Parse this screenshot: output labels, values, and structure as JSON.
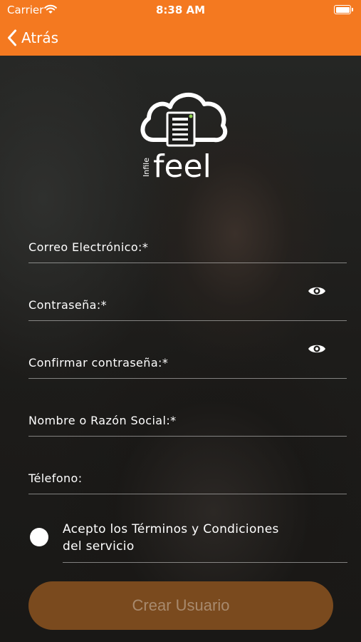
{
  "status_bar": {
    "carrier": "Carrier",
    "time": "8:38 AM"
  },
  "nav": {
    "back_label": "Atrás"
  },
  "logo": {
    "brand_small": "Infile",
    "brand_main": "feel"
  },
  "form": {
    "email_label": "Correo Electrónico:*",
    "password_label": "Contraseña:*",
    "confirm_label": "Confirmar contraseña:*",
    "name_label": "Nombre o Razón Social:*",
    "phone_label": "Télefono:"
  },
  "terms": {
    "prefix": "Acepto los ",
    "link": "Términos y Condiciones",
    "suffix": "del servicio"
  },
  "submit_label": "Crear Usuario",
  "colors": {
    "accent": "#f47920",
    "button_disabled": "#7a4a1e"
  }
}
